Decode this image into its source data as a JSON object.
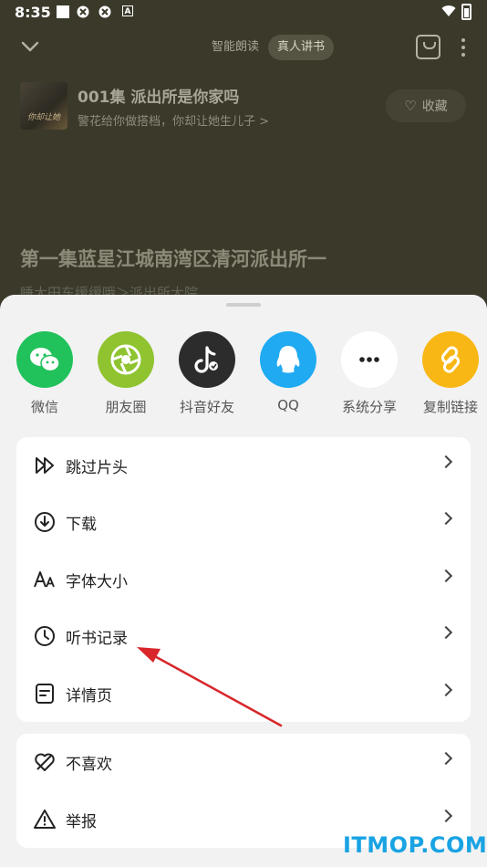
{
  "status_bar": {
    "time": "8:35",
    "icon_a": "A"
  },
  "top_bar": {
    "tabs": [
      "智能朗读",
      "真人讲书"
    ],
    "active_tab": "真人讲书"
  },
  "episode": {
    "cover_text": "你却让她",
    "title": "001集 派出所是你家吗",
    "subtitle": "警花给你做搭档，你却让她生儿子 >",
    "favorite_label": "收藏"
  },
  "chapter": {
    "title": "第一集蓝星江城南湾区清河派出所一",
    "line2": "睡大田东缓缓哦＞派出所大院"
  },
  "share": {
    "items": [
      {
        "label": "微信",
        "icon": "wechat-icon",
        "color": "#21c25b"
      },
      {
        "label": "朋友圈",
        "icon": "moments-icon",
        "color": "#8fc32f"
      },
      {
        "label": "抖音好友",
        "icon": "douyin-icon",
        "color": "#2c2c2c"
      },
      {
        "label": "QQ",
        "icon": "qq-icon",
        "color": "#1faaf2"
      },
      {
        "label": "系统分享",
        "icon": "more-icon",
        "color": "#ffffff"
      },
      {
        "label": "复制链接",
        "icon": "link-icon",
        "color": "#f8b714"
      }
    ]
  },
  "menu": {
    "group1": [
      {
        "label": "跳过片头",
        "icon": "skip-intro-icon"
      },
      {
        "label": "下载",
        "icon": "download-icon"
      },
      {
        "label": "字体大小",
        "icon": "font-size-icon"
      },
      {
        "label": "听书记录",
        "icon": "history-clock-icon"
      },
      {
        "label": "详情页",
        "icon": "details-icon"
      }
    ],
    "group2": [
      {
        "label": "不喜欢",
        "icon": "dislike-heart-icon"
      },
      {
        "label": "举报",
        "icon": "report-warning-icon"
      }
    ]
  },
  "annotation_color": "#d8262a",
  "watermark": "ITMOP.COM"
}
